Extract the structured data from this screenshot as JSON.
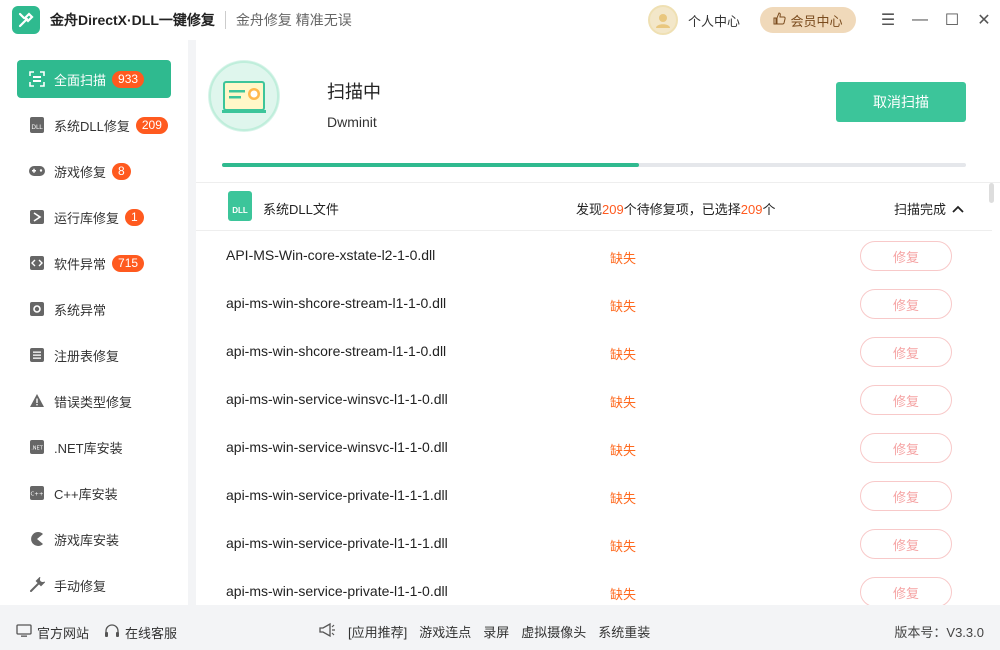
{
  "app": {
    "title": "金舟DirectX·DLL一键修复",
    "subtitle": "金舟修复 精准无误",
    "personal_center": "个人中心",
    "vip_center": "会员中心"
  },
  "sidebar": {
    "items": [
      {
        "label": "全面扫描",
        "badge": "933",
        "icon": "scan-icon"
      },
      {
        "label": "系统DLL修复",
        "badge": "209",
        "icon": "dll-icon"
      },
      {
        "label": "游戏修复",
        "badge": "8",
        "icon": "gamepad-icon"
      },
      {
        "label": "运行库修复",
        "badge": "1",
        "icon": "runtime-icon"
      },
      {
        "label": "软件异常",
        "badge": "715",
        "icon": "code-icon"
      },
      {
        "label": "系统异常",
        "badge": "",
        "icon": "gear-icon"
      },
      {
        "label": "注册表修复",
        "badge": "",
        "icon": "list-icon"
      },
      {
        "label": "错误类型修复",
        "badge": "",
        "icon": "warning-icon"
      },
      {
        "label": ".NET库安装",
        "badge": "",
        "icon": "dotnet-icon"
      },
      {
        "label": "C++库安装",
        "badge": "",
        "icon": "cpp-icon"
      },
      {
        "label": "游戏库安装",
        "badge": "",
        "icon": "pacman-icon"
      },
      {
        "label": "手动修复",
        "badge": "",
        "icon": "wrench-icon"
      }
    ]
  },
  "scan": {
    "status": "扫描中",
    "current_file": "Dwminit",
    "cancel_label": "取消扫描",
    "progress": 0.56
  },
  "group": {
    "title": "系统DLL文件",
    "summary_prefix": "发现",
    "found": "209",
    "summary_mid": "个待修复项，已选择",
    "selected": "209",
    "summary_suffix": "个",
    "done_label": "扫描完成"
  },
  "dll_rows": [
    {
      "name": "API-MS-Win-core-xstate-l2-1-0.dll",
      "state": "缺失",
      "action": "修复"
    },
    {
      "name": "api-ms-win-shcore-stream-l1-1-0.dll",
      "state": "缺失",
      "action": "修复"
    },
    {
      "name": "api-ms-win-shcore-stream-l1-1-0.dll",
      "state": "缺失",
      "action": "修复"
    },
    {
      "name": "api-ms-win-service-winsvc-l1-1-0.dll",
      "state": "缺失",
      "action": "修复"
    },
    {
      "name": "api-ms-win-service-winsvc-l1-1-0.dll",
      "state": "缺失",
      "action": "修复"
    },
    {
      "name": "api-ms-win-service-private-l1-1-1.dll",
      "state": "缺失",
      "action": "修复"
    },
    {
      "name": "api-ms-win-service-private-l1-1-1.dll",
      "state": "缺失",
      "action": "修复"
    },
    {
      "name": "api-ms-win-service-private-l1-1-0.dll",
      "state": "缺失",
      "action": "修复"
    }
  ],
  "footer": {
    "official_site": "官方网站",
    "online_service": "在线客服",
    "recommend": "[应用推荐]",
    "links": [
      "游戏连点",
      "录屏",
      "虚拟摄像头",
      "系统重装"
    ],
    "version": "版本号：V3.3.0"
  },
  "colors": {
    "accent": "#2fba8f",
    "badge": "#ff5a1f",
    "missing": "#ff6a1f"
  }
}
